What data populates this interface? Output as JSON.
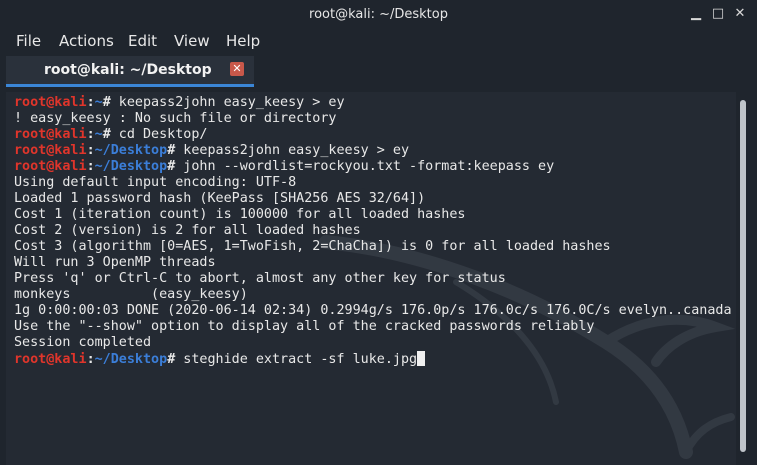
{
  "window": {
    "title": "root@kali: ~/Desktop",
    "min_glyph": "▁",
    "max_glyph": "□",
    "close_glyph": "✕"
  },
  "menu": {
    "items": [
      "File",
      "Actions",
      "Edit",
      "View",
      "Help"
    ]
  },
  "tab": {
    "label": "root@kali: ~/Desktop",
    "close_glyph": "✕"
  },
  "colors": {
    "prompt_user": "#e0352b",
    "prompt_path": "#3b7ed8",
    "tab_close": "#c8584a",
    "tab_underline": "#3b86d6"
  },
  "terminal": {
    "lines": [
      {
        "user": "root@kali",
        "sep": ":",
        "path": "~",
        "mark": "#",
        "cmd": " keepass2john easy_keesy > ey"
      },
      {
        "text": "! easy_keesy : No such file or directory"
      },
      {
        "user": "root@kali",
        "sep": ":",
        "path": "~",
        "mark": "#",
        "cmd": " cd Desktop/"
      },
      {
        "user": "root@kali",
        "sep": ":",
        "path": "~/Desktop",
        "mark": "#",
        "cmd": " keepass2john easy_keesy > ey"
      },
      {
        "user": "root@kali",
        "sep": ":",
        "path": "~/Desktop",
        "mark": "#",
        "cmd": " john --wordlist=rockyou.txt -format:keepass ey"
      },
      {
        "text": "Using default input encoding: UTF-8"
      },
      {
        "text": "Loaded 1 password hash (KeePass [SHA256 AES 32/64])"
      },
      {
        "text": "Cost 1 (iteration count) is 100000 for all loaded hashes"
      },
      {
        "text": "Cost 2 (version) is 2 for all loaded hashes"
      },
      {
        "text": "Cost 3 (algorithm [0=AES, 1=TwoFish, 2=ChaCha]) is 0 for all loaded hashes"
      },
      {
        "text": "Will run 3 OpenMP threads"
      },
      {
        "text": "Press 'q' or Ctrl-C to abort, almost any other key for status"
      },
      {
        "text": "monkeys          (easy_keesy)"
      },
      {
        "text": "1g 0:00:00:03 DONE (2020-06-14 02:34) 0.2994g/s 176.0p/s 176.0c/s 176.0C/s evelyn..canada"
      },
      {
        "text": "Use the \"--show\" option to display all of the cracked passwords reliably"
      },
      {
        "text": "Session completed"
      },
      {
        "user": "root@kali",
        "sep": ":",
        "path": "~/Desktop",
        "mark": "#",
        "cmd": " steghide extract -sf luke.jpg",
        "cursor": true
      }
    ]
  }
}
